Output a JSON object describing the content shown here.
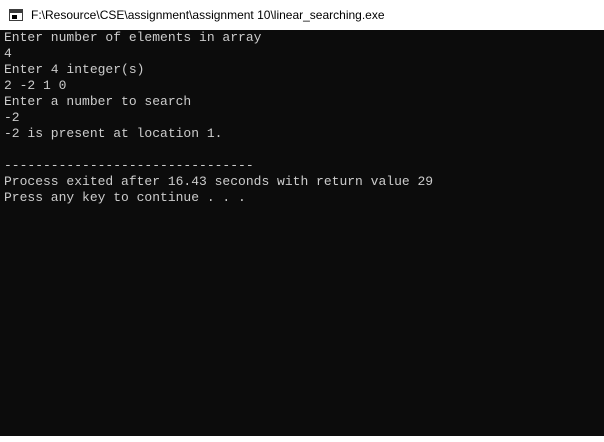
{
  "window": {
    "title": "F:\\Resource\\CSE\\assignment\\assignment 10\\linear_searching.exe",
    "icon": "console-app-icon"
  },
  "console": {
    "lines": [
      "Enter number of elements in array",
      "4",
      "Enter 4 integer(s)",
      "2 -2 1 0",
      "Enter a number to search",
      "-2",
      "-2 is present at location 1.",
      "",
      "--------------------------------",
      "Process exited after 16.43 seconds with return value 29",
      "Press any key to continue . . ."
    ]
  }
}
